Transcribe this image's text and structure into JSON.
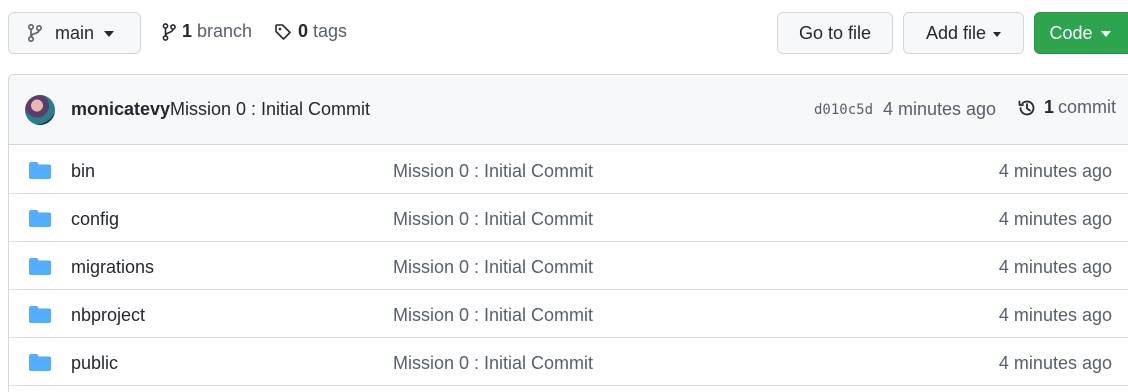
{
  "toolbar": {
    "branch_name": "main",
    "branch_count": "1",
    "branch_label": "branch",
    "tag_count": "0",
    "tag_label": "tags",
    "go_to_file_label": "Go to file",
    "add_file_label": "Add file",
    "code_label": "Code",
    "code_button_color": "#2da44e"
  },
  "latest_commit": {
    "author": "monicatevy",
    "message": "Mission 0 : Initial Commit",
    "sha": "d010c5d",
    "time": "4 minutes ago",
    "commit_count": "1",
    "commit_label": "commit"
  },
  "files": [
    {
      "name": "bin",
      "message": "Mission 0 : Initial Commit",
      "time": "4 minutes ago",
      "icon": "folder-icon"
    },
    {
      "name": "config",
      "message": "Mission 0 : Initial Commit",
      "time": "4 minutes ago",
      "icon": "folder-icon"
    },
    {
      "name": "migrations",
      "message": "Mission 0 : Initial Commit",
      "time": "4 minutes ago",
      "icon": "folder-icon"
    },
    {
      "name": "nbproject",
      "message": "Mission 0 : Initial Commit",
      "time": "4 minutes ago",
      "icon": "folder-icon"
    },
    {
      "name": "public",
      "message": "Mission 0 : Initial Commit",
      "time": "4 minutes ago",
      "icon": "folder-icon"
    }
  ],
  "colors": {
    "folder": "#54aeff",
    "border": "#d0d7de"
  }
}
